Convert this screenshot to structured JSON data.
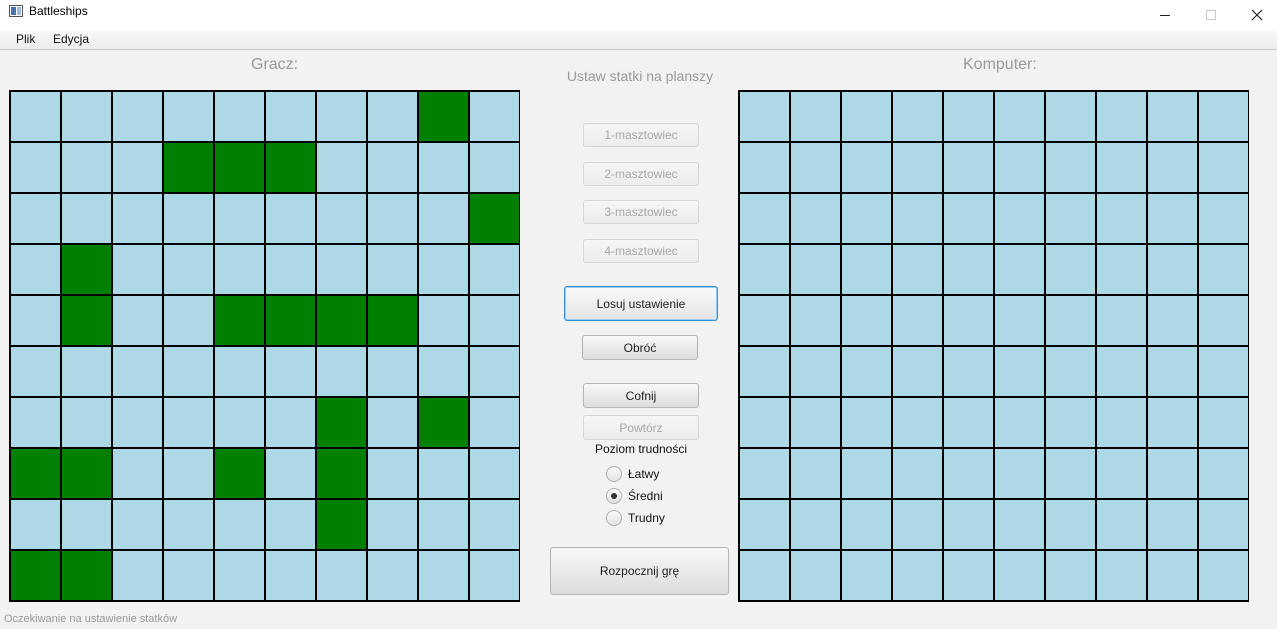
{
  "window": {
    "title": "Battleships",
    "icon": "app-window-icon"
  },
  "menu": {
    "items": [
      {
        "label": "Plik"
      },
      {
        "label": "Edycja"
      }
    ]
  },
  "player_board": {
    "title": "Gracz:",
    "rows": 10,
    "cols": 10,
    "water_color": "#add8e6",
    "ship_color": "#008000",
    "ship_cells": [
      [
        0,
        8
      ],
      [
        1,
        3
      ],
      [
        1,
        4
      ],
      [
        1,
        5
      ],
      [
        2,
        9
      ],
      [
        3,
        1
      ],
      [
        4,
        1
      ],
      [
        4,
        4
      ],
      [
        4,
        5
      ],
      [
        4,
        6
      ],
      [
        4,
        7
      ],
      [
        6,
        6
      ],
      [
        6,
        8
      ],
      [
        7,
        0
      ],
      [
        7,
        1
      ],
      [
        7,
        4
      ],
      [
        7,
        6
      ],
      [
        8,
        6
      ],
      [
        9,
        0
      ],
      [
        9,
        1
      ]
    ]
  },
  "computer_board": {
    "title": "Komputer:",
    "rows": 10,
    "cols": 10,
    "ship_cells": []
  },
  "setup_panel": {
    "title": "Ustaw statki na planszy",
    "ship_buttons": [
      {
        "label": "1-masztowiec",
        "enabled": false
      },
      {
        "label": "2-masztowiec",
        "enabled": false
      },
      {
        "label": "3-masztowiec",
        "enabled": false
      },
      {
        "label": "4-masztowiec",
        "enabled": false
      }
    ],
    "random_label": "Losuj ustawienie",
    "rotate_label": "Obróć",
    "undo_label": "Cofnij",
    "redo_label": "Powtórz",
    "redo_enabled": false,
    "difficulty_label": "Poziom trudności",
    "difficulty_options": [
      {
        "label": "Łatwy",
        "selected": false
      },
      {
        "label": "Średni",
        "selected": true
      },
      {
        "label": "Trudny",
        "selected": false
      }
    ],
    "start_label": "Rozpocznij grę"
  },
  "status_bar": {
    "text": "Oczekiwanie na ustawienie statków"
  }
}
